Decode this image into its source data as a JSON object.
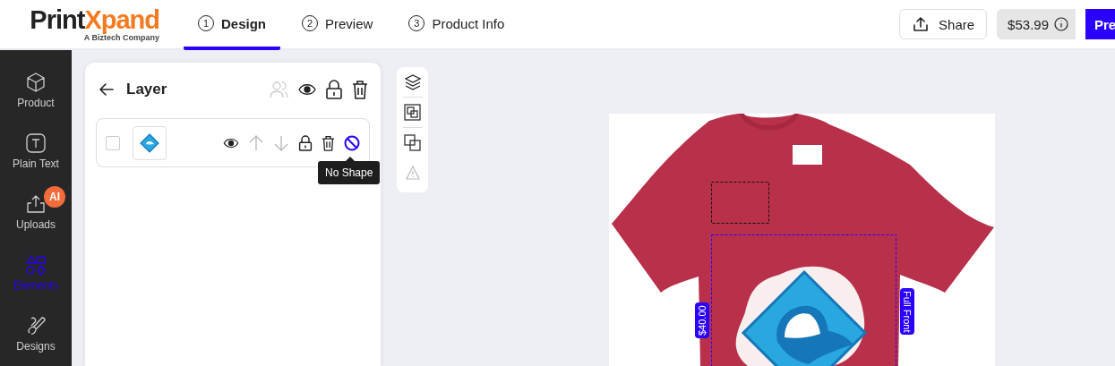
{
  "header": {
    "logo_parts": [
      "Print",
      "Xpand"
    ],
    "tagline": "A Biztech Company",
    "steps": [
      {
        "number": "1",
        "label": "Design",
        "selected": true
      },
      {
        "number": "2",
        "label": "Preview",
        "selected": false
      },
      {
        "number": "3",
        "label": "Product Info",
        "selected": false
      }
    ],
    "share_button": "Share",
    "price": "$53.99",
    "next_button": "Pre"
  },
  "sidebar": {
    "items": [
      {
        "kind": "product",
        "label": "Product",
        "selected": false
      },
      {
        "kind": "text",
        "label": "Plain Text",
        "selected": false
      },
      {
        "kind": "uploads",
        "label": "Uploads",
        "selected": false,
        "badge": "AI"
      },
      {
        "kind": "elements",
        "label": "Elements",
        "selected": true
      },
      {
        "kind": "designs",
        "label": "Designs",
        "selected": false
      }
    ]
  },
  "layer_panel": {
    "title": "Layer",
    "layers": [
      {
        "checked": false,
        "tooltip": "No Shape"
      }
    ]
  },
  "canvas": {
    "price_label": "$40.00",
    "area_label": "Full Front"
  }
}
